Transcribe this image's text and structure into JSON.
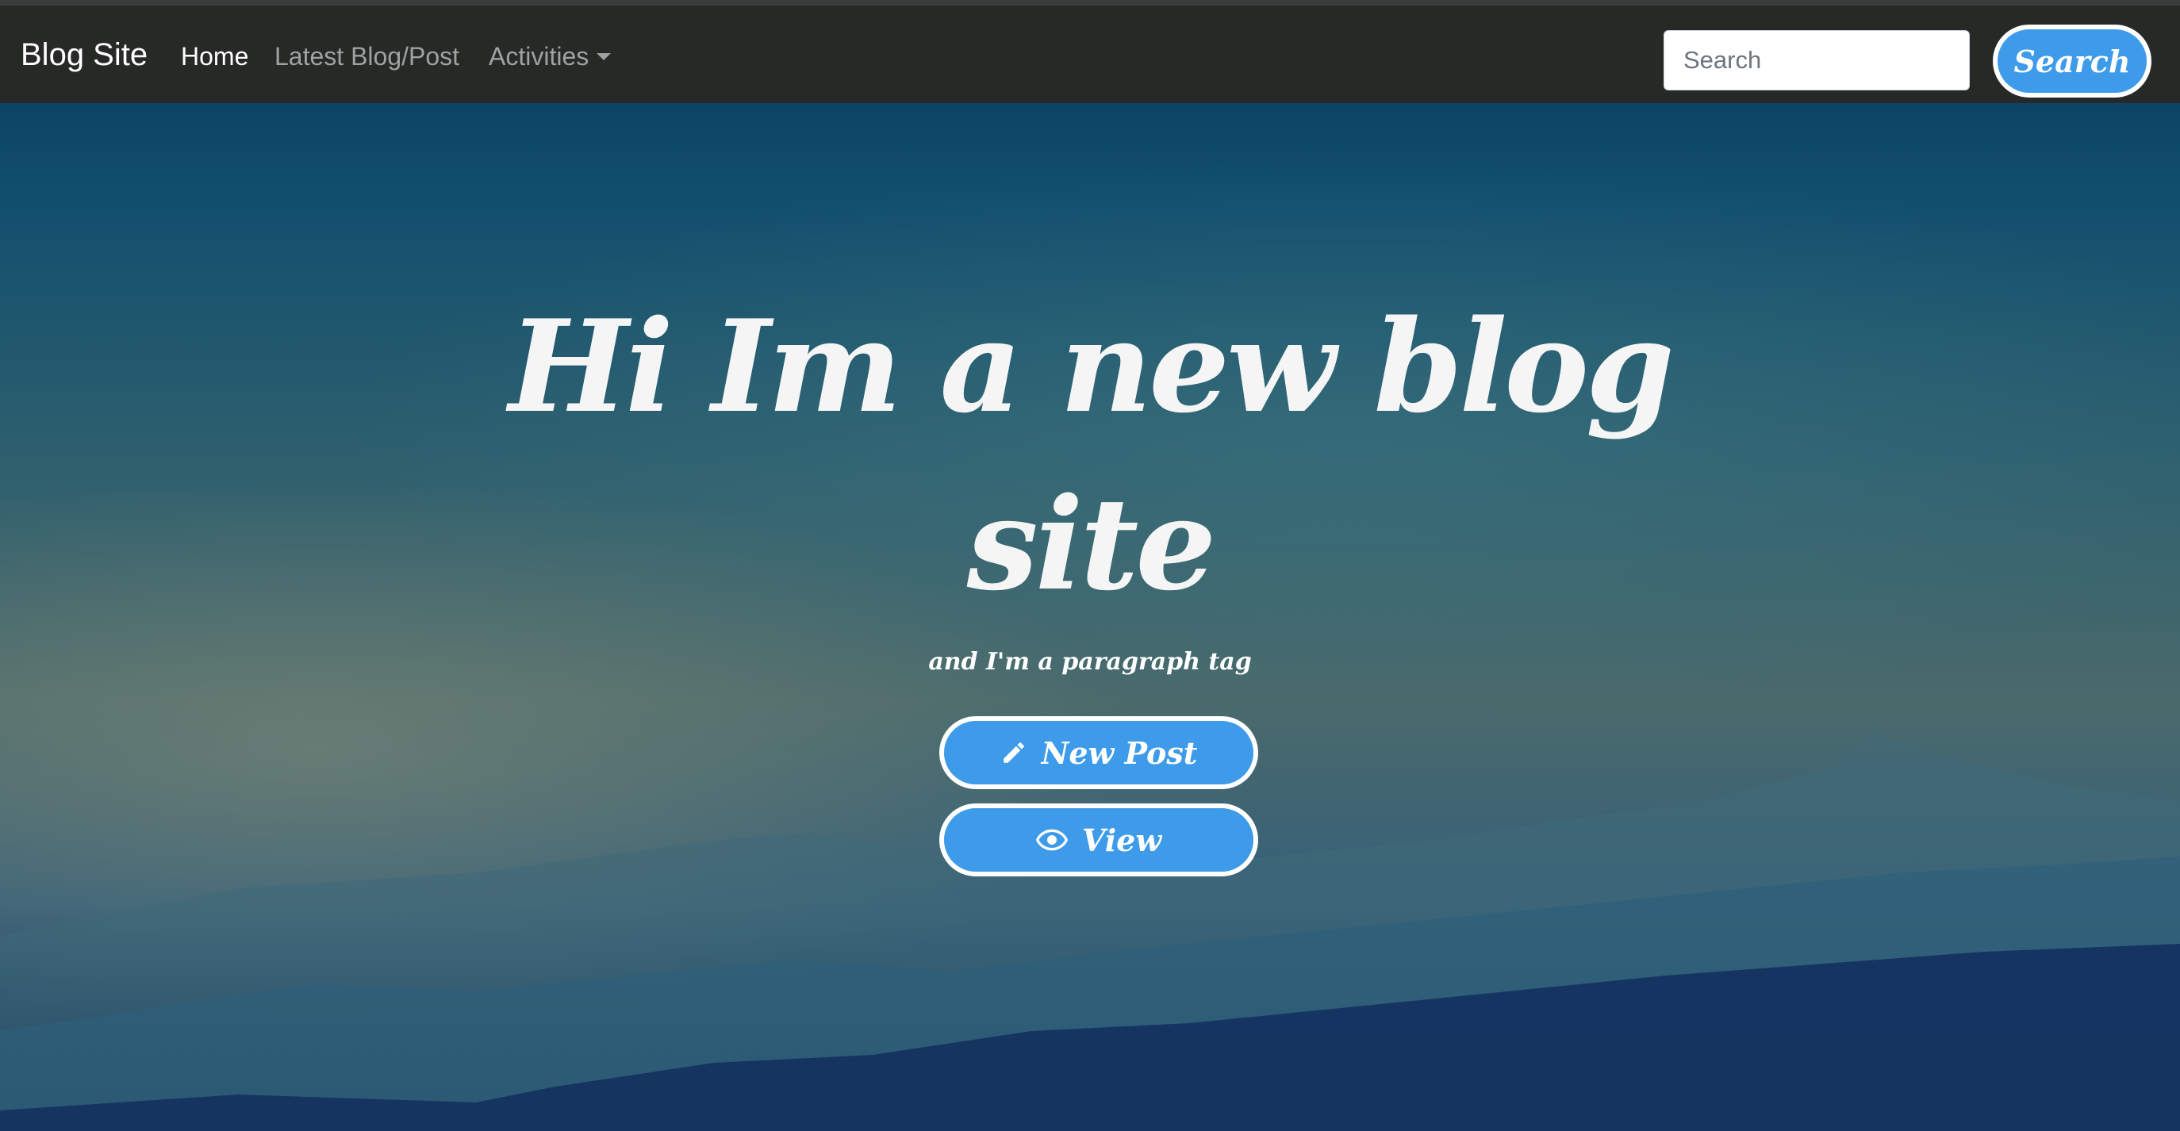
{
  "navbar": {
    "brand": "Blog Site",
    "links": [
      {
        "label": "Home"
      },
      {
        "label": "Latest Blog/Post"
      },
      {
        "label": "Activities"
      }
    ],
    "search": {
      "placeholder": "Search",
      "value": "",
      "button_label": "Search"
    }
  },
  "hero": {
    "title": "Hi Im a new blog site",
    "subtitle": "and I'm a paragraph tag",
    "buttons": [
      {
        "label": "New Post",
        "icon": "pencil-icon"
      },
      {
        "label": "View",
        "icon": "eye-icon"
      }
    ]
  },
  "colors": {
    "navbar_bg": "#272927",
    "accent_button": "#3d9be9",
    "active_link": "#ffffff",
    "inactive_link": "#9fa1a2"
  }
}
